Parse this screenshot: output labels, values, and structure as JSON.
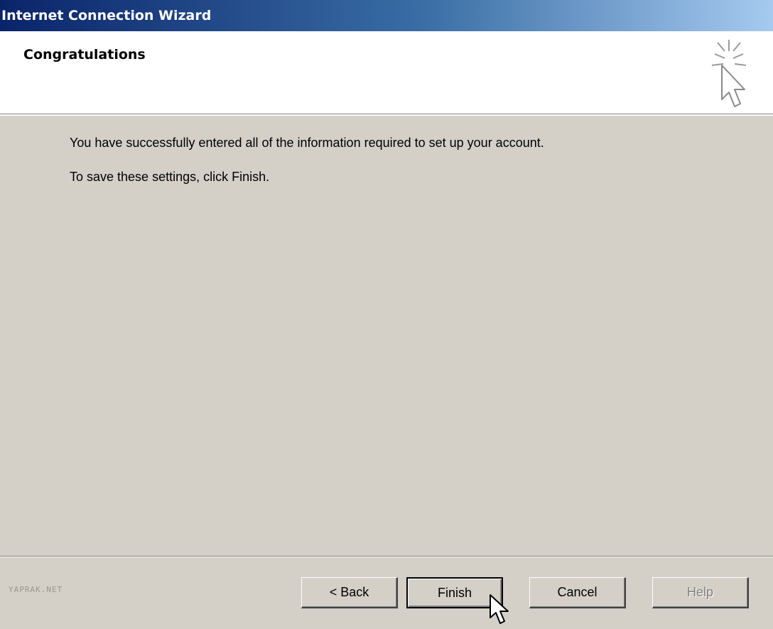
{
  "window": {
    "title": "Internet Connection Wizard"
  },
  "header": {
    "title": "Congratulations",
    "icon": "wizard-cursor-sparkle-icon"
  },
  "content": {
    "line1": "You have successfully entered all of the information required to set up your account.",
    "line2": "To save these settings, click Finish."
  },
  "footer": {
    "brand": "YAPRAK.NET",
    "buttons": {
      "back": "< Back",
      "finish": "Finish",
      "cancel": "Cancel",
      "help": "Help"
    }
  },
  "colors": {
    "titlebar_start": "#0a246a",
    "titlebar_end": "#a6caf0",
    "dialog_bg": "#d4d0c8"
  }
}
